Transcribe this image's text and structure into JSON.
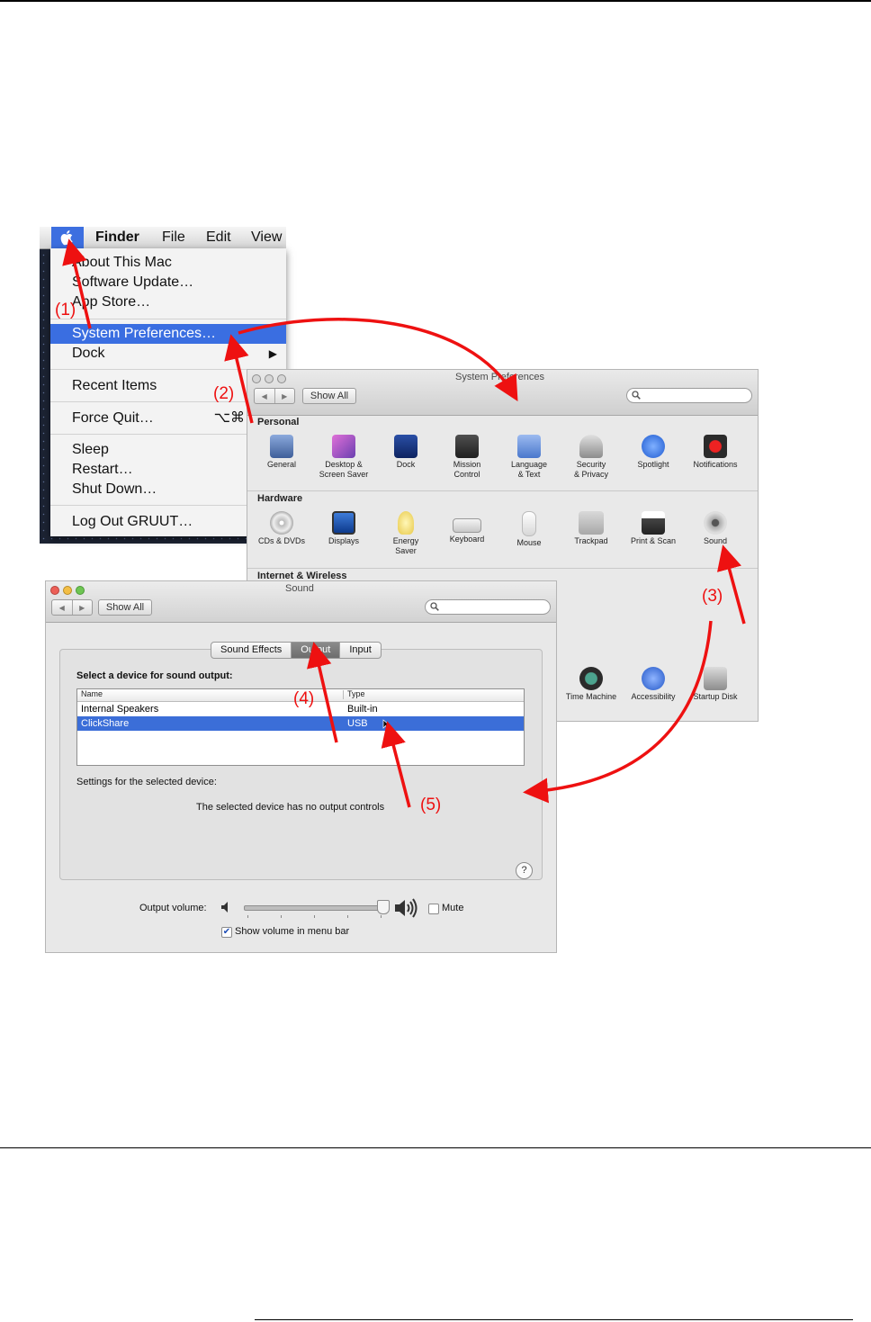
{
  "finder": {
    "menubar": {
      "app": "Finder",
      "file": "File",
      "edit": "Edit",
      "view": "View"
    },
    "menu_items": {
      "about": "About This Mac",
      "software_update": "Software Update…",
      "app_store": "App Store…",
      "system_prefs": "System Preferences…",
      "dock": "Dock",
      "recent": "Recent Items",
      "force_quit": "Force Quit…",
      "force_quit_shortcut": "⌥⌘",
      "sleep": "Sleep",
      "restart": "Restart…",
      "shutdown": "Shut Down…",
      "logout": "Log Out GRUUT…",
      "logout_shortcut": "⇧⌘("
    }
  },
  "sysprefs": {
    "title": "System Preferences",
    "show_all": "Show All",
    "sections": {
      "personal": "Personal",
      "hardware": "Hardware",
      "internet": "Internet & Wireless"
    },
    "personal_panes": [
      {
        "l1": "General",
        "l2": ""
      },
      {
        "l1": "Desktop &",
        "l2": "Screen Saver"
      },
      {
        "l1": "Dock",
        "l2": ""
      },
      {
        "l1": "Mission",
        "l2": "Control"
      },
      {
        "l1": "Language",
        "l2": "& Text"
      },
      {
        "l1": "Security",
        "l2": "& Privacy"
      },
      {
        "l1": "Spotlight",
        "l2": ""
      },
      {
        "l1": "Notifications",
        "l2": ""
      }
    ],
    "hardware_panes": [
      {
        "l1": "CDs & DVDs",
        "l2": ""
      },
      {
        "l1": "Displays",
        "l2": ""
      },
      {
        "l1": "Energy",
        "l2": "Saver"
      },
      {
        "l1": "Keyboard",
        "l2": ""
      },
      {
        "l1": "Mouse",
        "l2": ""
      },
      {
        "l1": "Trackpad",
        "l2": ""
      },
      {
        "l1": "Print & Scan",
        "l2": ""
      },
      {
        "l1": "Sound",
        "l2": ""
      }
    ],
    "system_panes": [
      {
        "l1": "Time Machine"
      },
      {
        "l1": "Accessibility"
      },
      {
        "l1": "Startup Disk"
      }
    ]
  },
  "sound": {
    "title": "Sound",
    "show_all": "Show All",
    "tabs": [
      "Sound Effects",
      "Output",
      "Input"
    ],
    "active_tab": "Output",
    "select_label": "Select a device for sound output:",
    "columns": [
      "Name",
      "Type"
    ],
    "devices": [
      {
        "name": "Internal Speakers",
        "type": "Built-in"
      },
      {
        "name": "ClickShare",
        "type": "USB"
      }
    ],
    "selected_device": "ClickShare",
    "settings_label": "Settings for the selected device:",
    "no_controls": "The selected device has no output controls",
    "help": "?",
    "output_volume_label": "Output volume:",
    "volume_level": 1.0,
    "mute_label": "Mute",
    "mute_checked": false,
    "show_volume_label": "Show volume in menu bar",
    "show_volume_checked": true
  },
  "annotations": [
    "(1)",
    "(2)",
    "(3)",
    "(4)",
    "(5)"
  ],
  "colors": {
    "arrow": "#e11111",
    "selection": "#3a6ee1"
  }
}
